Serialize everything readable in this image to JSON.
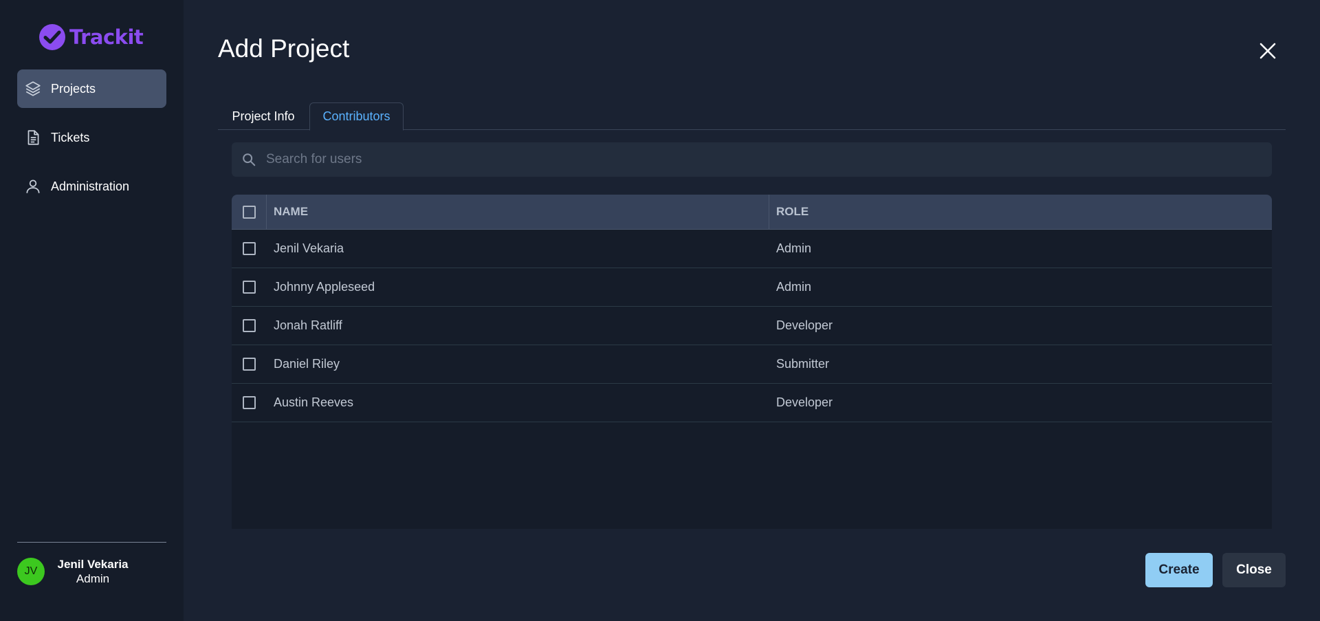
{
  "app": {
    "name": "Trackit",
    "brand_color": "#8b4cf0"
  },
  "sidebar": {
    "items": [
      {
        "label": "Projects",
        "icon": "layers-icon",
        "active": true
      },
      {
        "label": "Tickets",
        "icon": "document-icon",
        "active": false
      },
      {
        "label": "Administration",
        "icon": "user-icon",
        "active": false
      }
    ],
    "user": {
      "initials": "JV",
      "name": "Jenil Vekaria",
      "role": "Admin",
      "avatar_color": "#3cc81f"
    }
  },
  "dialog": {
    "title": "Add Project",
    "tabs": [
      {
        "label": "Project Info",
        "active": false
      },
      {
        "label": "Contributors",
        "active": true
      }
    ],
    "search": {
      "placeholder": "Search for users",
      "value": ""
    },
    "table": {
      "columns": [
        "NAME",
        "ROLE"
      ],
      "rows": [
        {
          "name": "Jenil Vekaria",
          "role": "Admin",
          "checked": false
        },
        {
          "name": "Johnny Appleseed",
          "role": "Admin",
          "checked": false
        },
        {
          "name": "Jonah Ratliff",
          "role": "Developer",
          "checked": false
        },
        {
          "name": "Daniel Riley",
          "role": "Submitter",
          "checked": false
        },
        {
          "name": "Austin Reeves",
          "role": "Developer",
          "checked": false
        }
      ]
    },
    "buttons": {
      "create_label": "Create",
      "close_label": "Close"
    },
    "accent_color": "#5ab2ff"
  }
}
